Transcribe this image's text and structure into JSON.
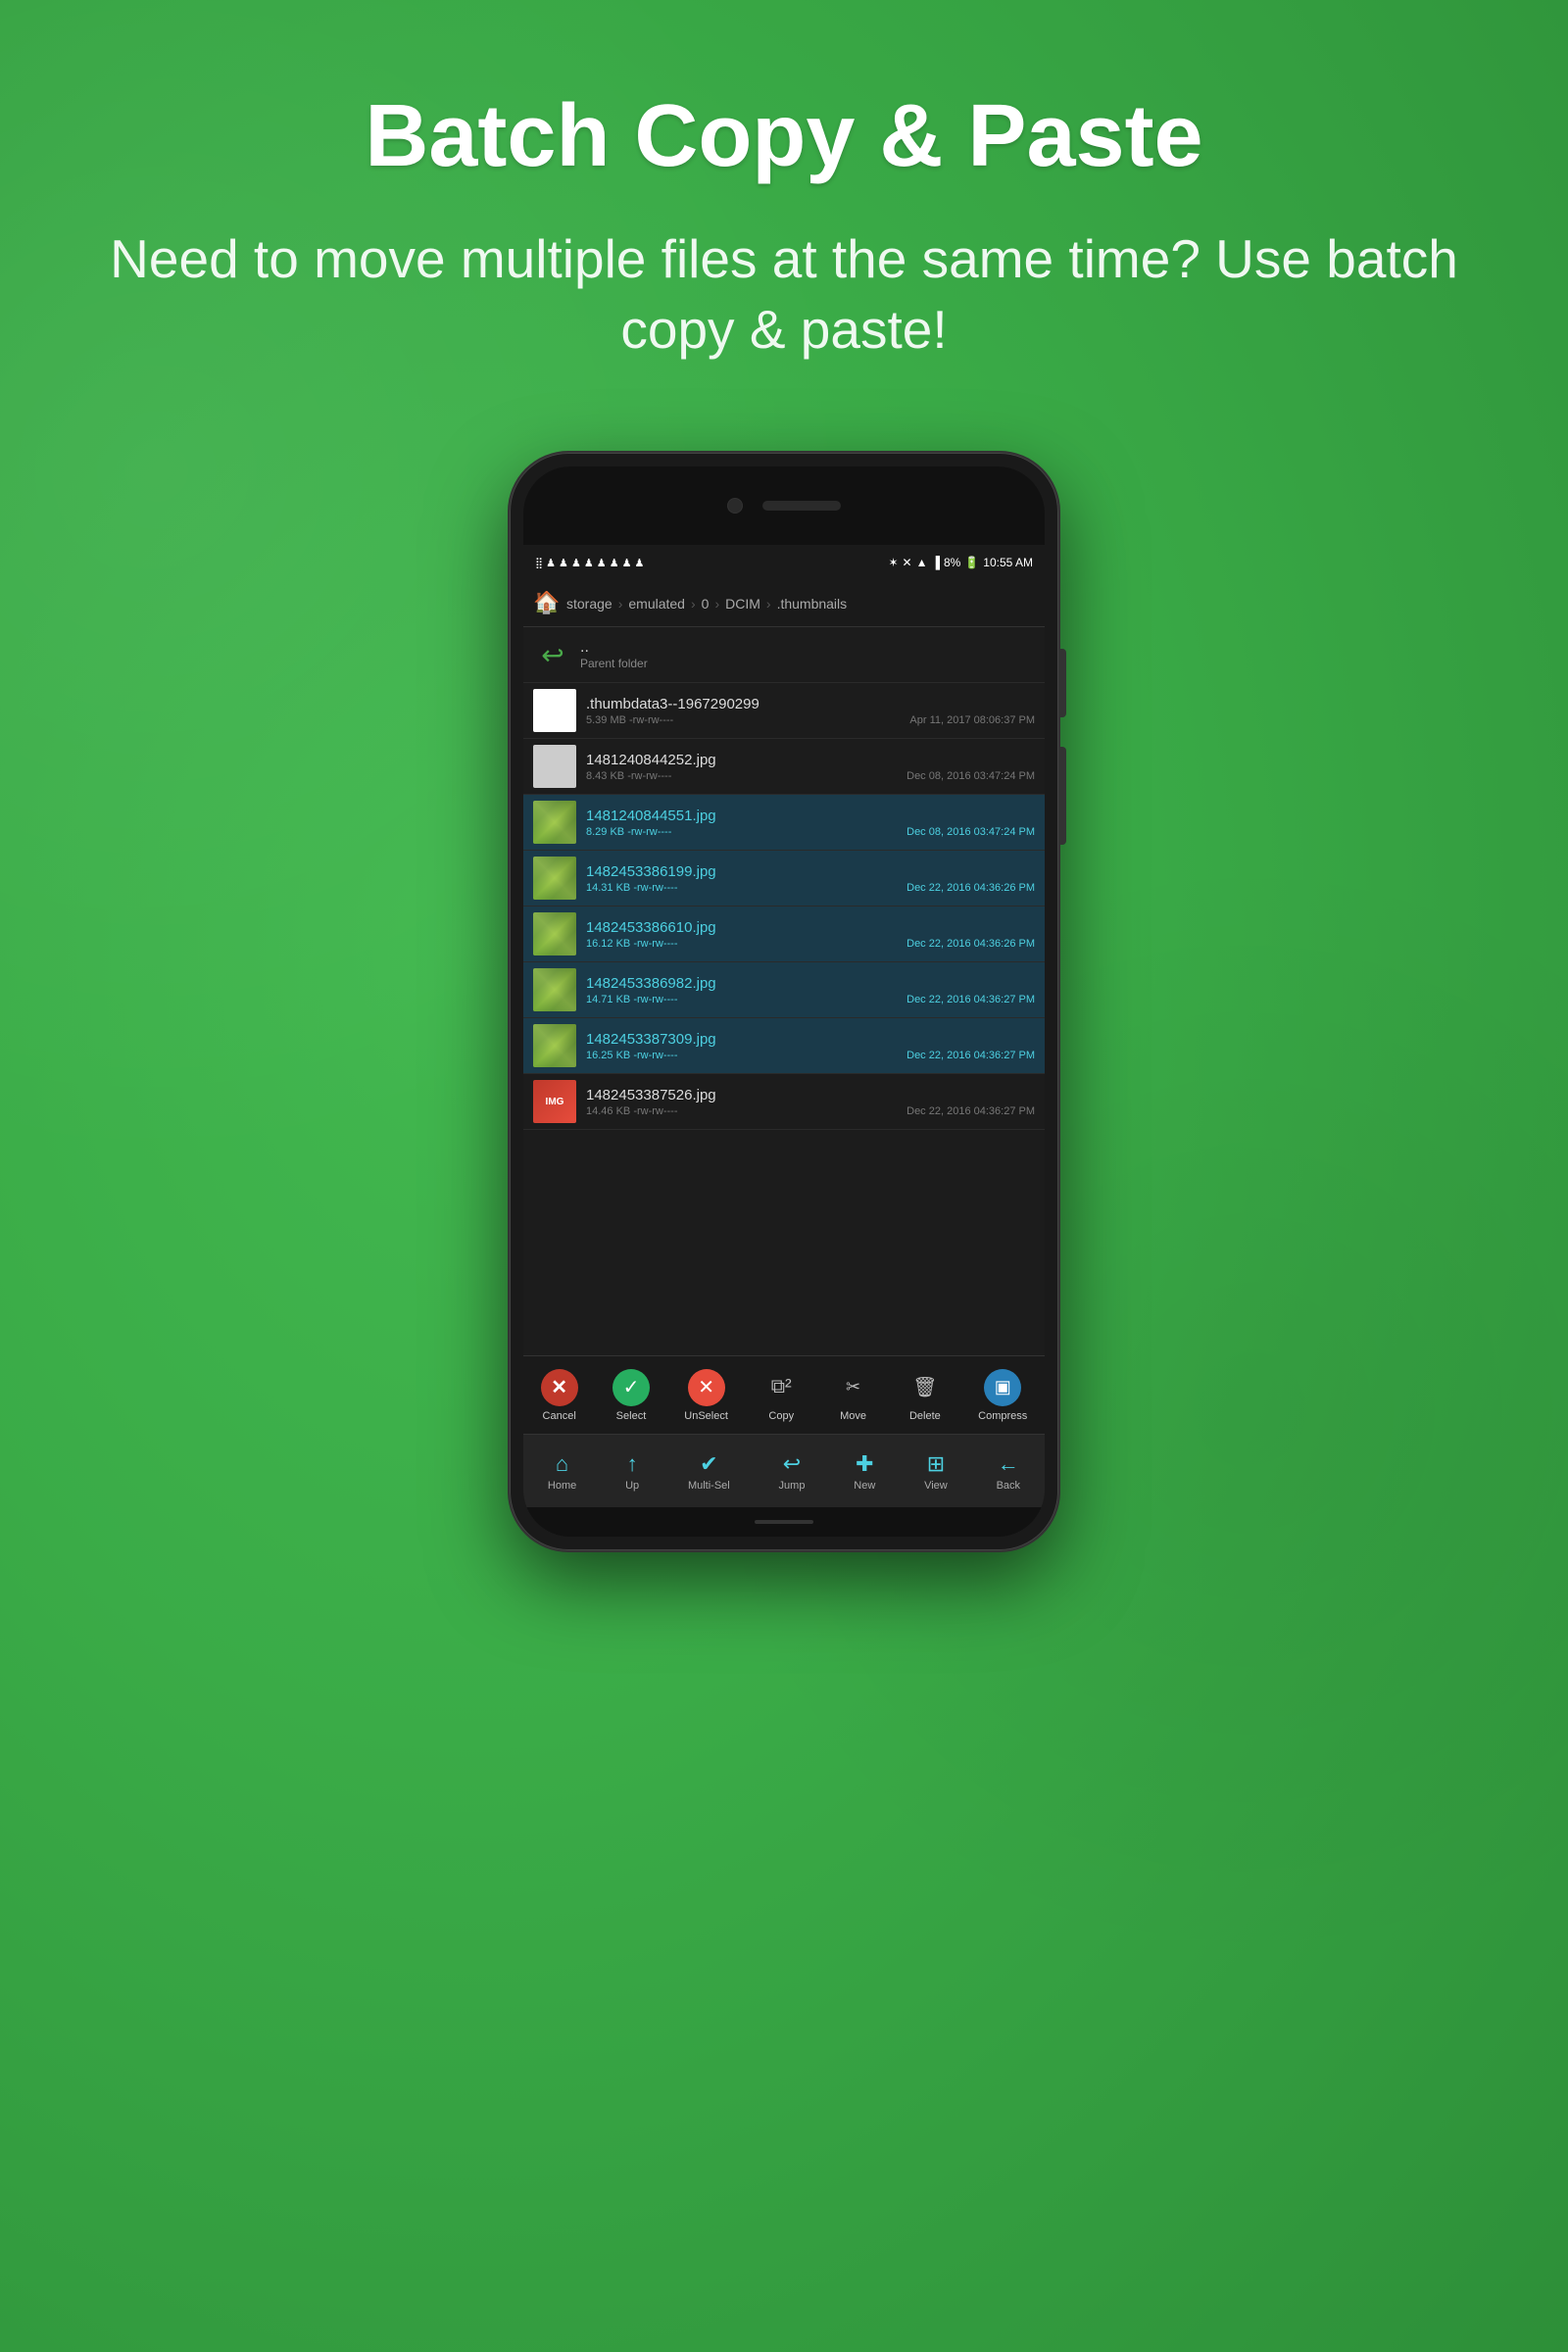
{
  "page": {
    "background_color": "#3aab47",
    "title": "Batch Copy & Paste",
    "subtitle": "Need to move multiple files at the same time? Use batch copy & paste!"
  },
  "phone": {
    "status_bar": {
      "time": "10:55 AM",
      "battery": "8%",
      "signal": "▲",
      "wifi": "wifi"
    },
    "breadcrumb": {
      "segments": [
        "storage",
        "emulated",
        "0",
        "DCIM",
        ".thumbnails"
      ]
    },
    "parent_folder": {
      "name": "..",
      "label": "Parent folder"
    },
    "files": [
      {
        "name": ".thumbdata3--1967290299",
        "size": "5.39 MB -rw-rw----",
        "date": "Apr 11, 2017 08:06:37 PM",
        "type": "data",
        "selected": false
      },
      {
        "name": "1481240844252.jpg",
        "size": "8.43 KB -rw-rw----",
        "date": "Dec 08, 2016 03:47:24 PM",
        "type": "image_gray",
        "selected": false
      },
      {
        "name": "1481240844551.jpg",
        "size": "8.29 KB -rw-rw----",
        "date": "Dec 08, 2016 03:47:24 PM",
        "type": "image_green",
        "selected": true
      },
      {
        "name": "1482453386199.jpg",
        "size": "14.31 KB -rw-rw----",
        "date": "Dec 22, 2016 04:36:26 PM",
        "type": "image_green",
        "selected": true
      },
      {
        "name": "1482453386610.jpg",
        "size": "16.12 KB -rw-rw----",
        "date": "Dec 22, 2016 04:36:26 PM",
        "type": "image_green",
        "selected": true
      },
      {
        "name": "1482453386982.jpg",
        "size": "14.71 KB -rw-rw----",
        "date": "Dec 22, 2016 04:36:27 PM",
        "type": "image_green",
        "selected": true
      },
      {
        "name": "1482453387309.jpg",
        "size": "16.25 KB -rw-rw----",
        "date": "Dec 22, 2016 04:36:27 PM",
        "type": "image_green",
        "selected": true
      },
      {
        "name": "1482453387526.jpg",
        "size": "14.46 KB -rw-rw----",
        "date": "Dec 22, 2016 04:36:27 PM",
        "type": "image_red",
        "selected": false
      }
    ],
    "action_toolbar": {
      "buttons": [
        {
          "id": "cancel",
          "label": "Cancel",
          "icon": "✕",
          "color": "#c0392b",
          "bg": "#c0392b"
        },
        {
          "id": "select",
          "label": "Select",
          "icon": "✓",
          "color": "#27ae60",
          "bg": "#27ae60"
        },
        {
          "id": "unselect",
          "label": "UnSelect",
          "icon": "✕",
          "color": "#e74c3c",
          "bg": "#e74c3c"
        },
        {
          "id": "copy",
          "label": "Copy",
          "icon": "⧉",
          "color": "#aaa",
          "bg": "transparent"
        },
        {
          "id": "move",
          "label": "Move",
          "icon": "✂",
          "color": "#aaa",
          "bg": "transparent"
        },
        {
          "id": "delete",
          "label": "Delete",
          "icon": "🗑",
          "color": "#aaa",
          "bg": "transparent"
        },
        {
          "id": "compress",
          "label": "Compress",
          "icon": "⊞",
          "color": "#2980b9",
          "bg": "#2980b9"
        }
      ]
    },
    "nav_bar": {
      "buttons": [
        {
          "id": "home",
          "label": "Home",
          "icon": "⌂",
          "color": "#4dd0e1"
        },
        {
          "id": "up",
          "label": "Up",
          "icon": "↑",
          "color": "#4dd0e1"
        },
        {
          "id": "multisel",
          "label": "Multi-Sel",
          "icon": "✓",
          "color": "#4dd0e1"
        },
        {
          "id": "jump",
          "label": "Jump",
          "icon": "↩",
          "color": "#4dd0e1"
        },
        {
          "id": "new",
          "label": "New",
          "icon": "✚",
          "color": "#4dd0e1"
        },
        {
          "id": "view",
          "label": "View",
          "icon": "⊞",
          "color": "#4dd0e1"
        },
        {
          "id": "back",
          "label": "Back",
          "icon": "←",
          "color": "#4dd0e1"
        }
      ]
    }
  }
}
